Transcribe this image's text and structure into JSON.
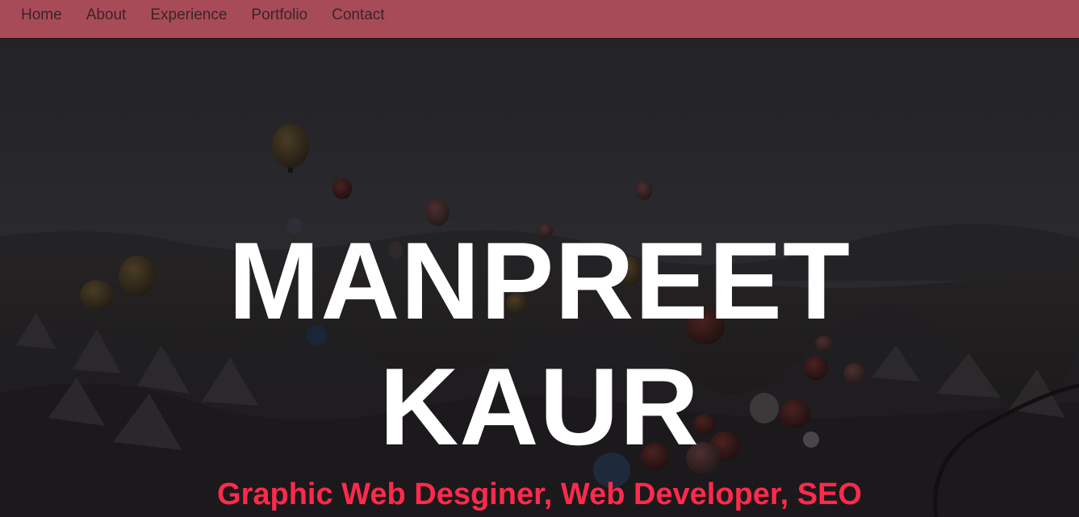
{
  "nav": {
    "items": [
      {
        "label": "Home"
      },
      {
        "label": "About"
      },
      {
        "label": "Experience"
      },
      {
        "label": "Portfolio"
      },
      {
        "label": "Contact"
      }
    ]
  },
  "hero": {
    "name_line1": "MANPREET",
    "name_line2": "KAUR",
    "subtitle": "Graphic Web Desginer, Web Developer, SEO"
  },
  "colors": {
    "nav_background": "#a84b58",
    "nav_text": "#3a2428",
    "title": "#ffffff",
    "subtitle": "#ff2a4c"
  }
}
